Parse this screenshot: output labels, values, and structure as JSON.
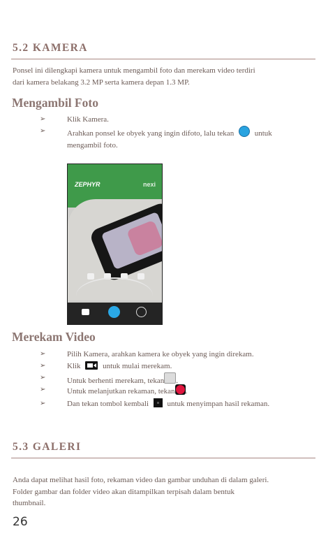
{
  "section_52": {
    "title": "5.2 KAMERA",
    "paragraph_lines": [
      "Ponsel ini dilengkapi kamera untuk mengambil foto dan merekam video terdiri",
      "dari kamera belakang 3.2 MP serta kamera depan 1.3 MP."
    ]
  },
  "foto": {
    "heading": "Mengambil Foto",
    "bullets": [
      {
        "text": "Klik Kamera."
      },
      {
        "before": "Arahkan ponsel ke obyek yang ingin difoto, lalu tekan",
        "after": "untuk",
        "line2": "mengambil foto.",
        "icon": "blue-circle-shutter-icon"
      }
    ],
    "screenshot": {
      "brand_left": "ZEPHYR",
      "brand_right": "nexi",
      "colors": {
        "shutter": "#2aa8e6",
        "banner": "#3f9a4a"
      }
    }
  },
  "video": {
    "heading": "Merekam Video",
    "bullets": [
      {
        "text": "Pilih Kamera, arahkan kamera ke obyek yang ingin direkam."
      },
      {
        "before": "Klik",
        "after": "untuk mulai merekam.",
        "icon": "video-camera-icon"
      },
      {
        "before": "Untuk berhenti merekam, tekan",
        "after": ".",
        "icon": "stop-square-icon"
      },
      {
        "before": "Untuk melanjutkan rekaman, tekan",
        "after": ".",
        "icon": "red-record-icon"
      },
      {
        "before": "Dan tekan tombol kembali",
        "after": "untuk menyimpan hasil rekaman.",
        "icon": "back-button-icon"
      }
    ]
  },
  "section_53": {
    "title": "5.3 GALERI",
    "paragraph_lines": [
      "Anda dapat melihat hasil foto, rekaman video dan gambar unduhan di dalam galeri.",
      "Folder gambar dan folder video akan ditampilkan terpisah dalam bentuk",
      "thumbnail."
    ]
  },
  "page_number": "26",
  "accent_colors": {
    "heading": "#8c6e69",
    "rule": "#a88782",
    "record": "#e0163f"
  }
}
